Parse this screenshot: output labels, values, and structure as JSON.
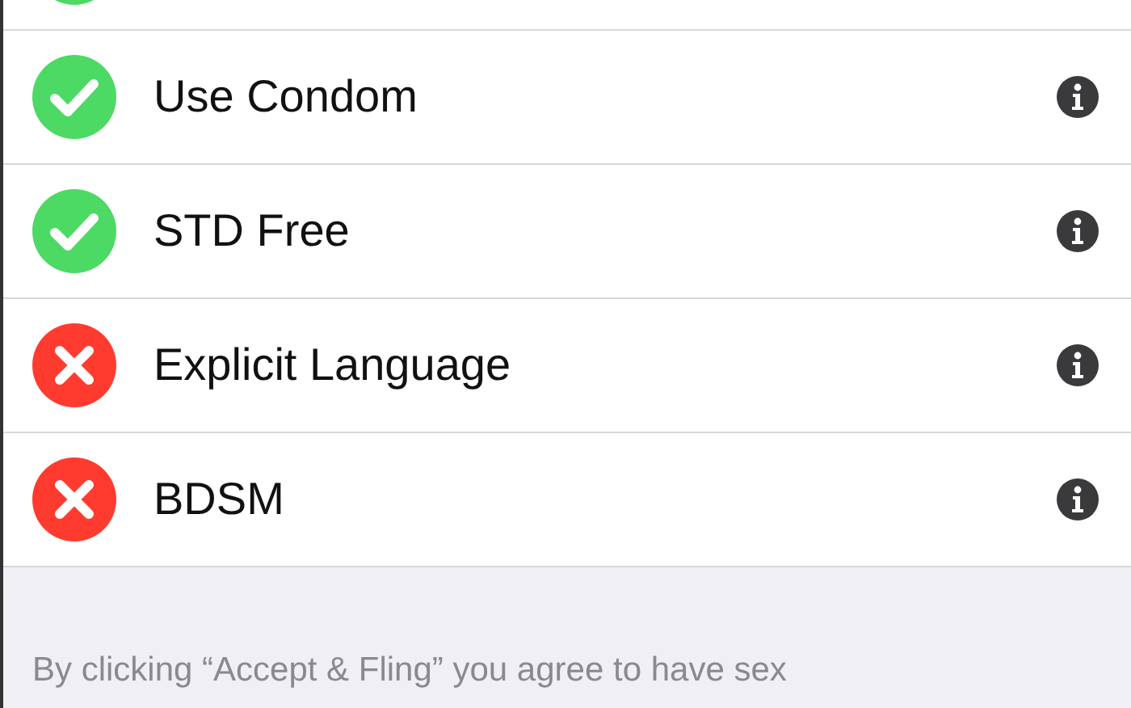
{
  "items": [
    {
      "agreed": true
    },
    {
      "label": "Use Condom",
      "agreed": true
    },
    {
      "label": "STD Free",
      "agreed": true
    },
    {
      "label": "Explicit Language",
      "agreed": false
    },
    {
      "label": "BDSM",
      "agreed": false
    }
  ],
  "footer": {
    "text": "By clicking “Accept & Fling” you agree to have sex"
  }
}
